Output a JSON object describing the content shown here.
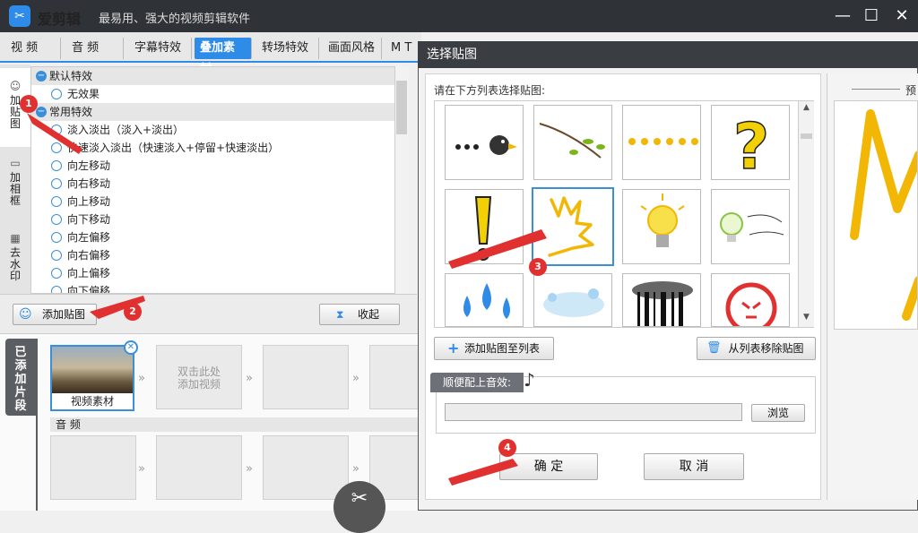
{
  "app": {
    "name": "爱剪辑",
    "tagline": "最易用、强大的视频剪辑软件"
  },
  "window_buttons": [
    "—",
    "☐",
    "✕"
  ],
  "tabs": [
    {
      "label": "视  频"
    },
    {
      "label": "音  频"
    },
    {
      "label": "字幕特效"
    },
    {
      "label": "叠加素材",
      "active": true
    },
    {
      "label": "转场特效"
    },
    {
      "label": "画面风格"
    },
    {
      "label": "M T"
    }
  ],
  "side_tabs": [
    {
      "label": "加\n贴\n图",
      "icon": "smiley-add-icon",
      "active": true
    },
    {
      "label": "加\n相\n框",
      "icon": "frame-add-icon"
    },
    {
      "label": "去\n水\n印",
      "icon": "watermark-remove-icon"
    }
  ],
  "effects": {
    "groups": [
      {
        "name": "默认特效",
        "items": [
          "无效果"
        ]
      },
      {
        "name": "常用特效",
        "items": [
          "淡入淡出（淡入+淡出）",
          "快速淡入淡出（快速淡入+停留+快速淡出）",
          "向左移动",
          "向右移动",
          "向上移动",
          "向下移动",
          "向左偏移",
          "向右偏移",
          "向上偏移",
          "向下偏移"
        ]
      }
    ]
  },
  "buttons": {
    "add_sticker": "添加贴图",
    "collapse": "收起"
  },
  "timeline": {
    "side_label": "已\n添\n加\n片\n段",
    "clip_label": "视频素材",
    "placeholder": "双击此处\n添加视频",
    "audio_label": "音  频"
  },
  "dialog": {
    "title": "选择贴图",
    "instruction": "请在下方列表选择贴图:",
    "preview_label": "预",
    "add_to_list": "添加贴图至列表",
    "remove_from_list": "从列表移除贴图",
    "sound_label": "顺便配上音效:",
    "browse": "浏览",
    "confirm": "确  定",
    "cancel": "取  消"
  },
  "annotations": [
    "1",
    "2",
    "3",
    "4"
  ],
  "colors": {
    "accent": "#2e8be8",
    "titlebar": "#2f3236",
    "badge": "#e03030",
    "sticker_yellow": "#f2b705"
  }
}
